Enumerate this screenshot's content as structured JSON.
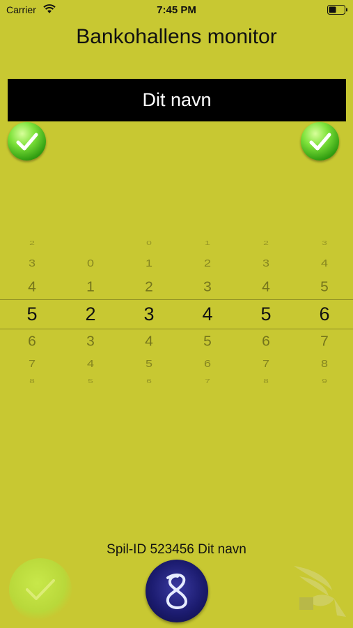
{
  "status": {
    "carrier": "Carrier",
    "time": "7:45 PM"
  },
  "header": {
    "title": "Bankohallens monitor"
  },
  "player": {
    "name": "Dit navn"
  },
  "picker": {
    "selected": [
      "5",
      "2",
      "3",
      "4",
      "5",
      "6"
    ],
    "columns": [
      [
        "2",
        "3",
        "4",
        "5",
        "6",
        "7",
        "8"
      ],
      [
        "",
        "0",
        "1",
        "2",
        "3",
        "4",
        "5"
      ],
      [
        "0",
        "1",
        "2",
        "3",
        "4",
        "5",
        "6"
      ],
      [
        "1",
        "2",
        "3",
        "4",
        "5",
        "6",
        "7"
      ],
      [
        "2",
        "3",
        "4",
        "5",
        "6",
        "7",
        "8"
      ],
      [
        "3",
        "4",
        "5",
        "6",
        "7",
        "8",
        "9"
      ]
    ]
  },
  "footer": {
    "spil_label": "Spil-ID 523456 Dit navn"
  },
  "colors": {
    "background": "#c8c832",
    "name_bar": "#000000",
    "check_green": "#4cc41c",
    "center_button": "#1c1c70"
  },
  "icons": {
    "left_check": "check-icon",
    "right_check": "check-icon",
    "bottom_check": "check-icon",
    "center": "infinity-swirl-icon",
    "logo": "bird-logo"
  }
}
